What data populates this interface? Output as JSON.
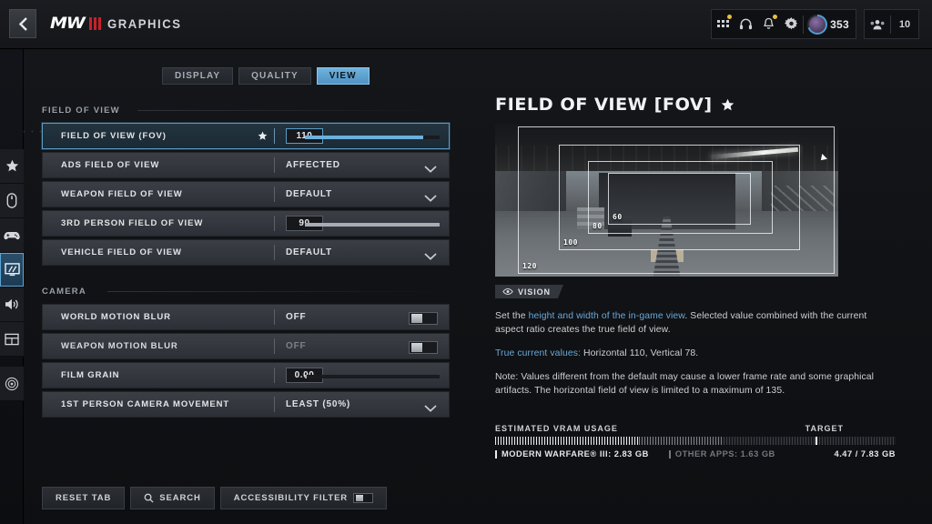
{
  "header": {
    "back_icon": "chevron-left-icon",
    "logo_text": "MW",
    "title": "GRAPHICS",
    "icons": [
      {
        "name": "apps-grid-icon",
        "badge": true
      },
      {
        "name": "headset-icon",
        "badge": false
      },
      {
        "name": "bell-icon",
        "badge": true
      },
      {
        "name": "gear-icon",
        "badge": false
      }
    ],
    "currency_value": "353",
    "squad_icon": "squad-icon",
    "squad_value": "10"
  },
  "rail": {
    "items": [
      {
        "name": "star-icon",
        "active": false
      },
      {
        "name": "mouse-icon",
        "active": false
      },
      {
        "name": "gamepad-icon",
        "active": false
      },
      {
        "name": "display-icon",
        "active": true
      },
      {
        "name": "audio-icon",
        "active": false
      },
      {
        "name": "interface-icon",
        "active": false
      },
      {
        "name": "telemetry-icon",
        "active": false
      }
    ]
  },
  "tabs": [
    {
      "label": "DISPLAY",
      "active": false
    },
    {
      "label": "QUALITY",
      "active": false
    },
    {
      "label": "VIEW",
      "active": true
    }
  ],
  "sections": [
    {
      "title": "FIELD OF VIEW",
      "rows": [
        {
          "label": "FIELD OF VIEW (FOV)",
          "type": "slider",
          "value": "110",
          "fill_percent": 88,
          "selected": true,
          "favorite": true
        },
        {
          "label": "ADS FIELD OF VIEW",
          "type": "dropdown",
          "value": "AFFECTED"
        },
        {
          "label": "WEAPON FIELD OF VIEW",
          "type": "dropdown",
          "value": "DEFAULT"
        },
        {
          "label": "3RD PERSON FIELD OF VIEW",
          "type": "slider",
          "value": "90",
          "fill_percent": 100
        },
        {
          "label": "VEHICLE FIELD OF VIEW",
          "type": "dropdown",
          "value": "DEFAULT"
        }
      ]
    },
    {
      "title": "CAMERA",
      "rows": [
        {
          "label": "WORLD MOTION BLUR",
          "type": "toggle",
          "value": "OFF",
          "on": false
        },
        {
          "label": "WEAPON MOTION BLUR",
          "type": "toggle",
          "value": "OFF",
          "on": false,
          "dimmed": true
        },
        {
          "label": "FILM GRAIN",
          "type": "slider",
          "value": "0.00",
          "fill_percent": 0
        },
        {
          "label": "1ST PERSON CAMERA MOVEMENT",
          "type": "dropdown",
          "value": "LEAST (50%)"
        }
      ]
    }
  ],
  "bottom_bar": {
    "reset_label": "RESET TAB",
    "search_label": "SEARCH",
    "search_icon": "magnifier-icon",
    "accessibility_label": "ACCESSIBILITY FILTER",
    "accessibility_on": false
  },
  "detail": {
    "title": "FIELD OF VIEW [FOV]",
    "favorite_icon": "star-icon",
    "preview": {
      "frames": [
        {
          "label": "120",
          "value": 120
        },
        {
          "label": "100",
          "value": 100
        },
        {
          "label": "80",
          "value": 80
        },
        {
          "label": "60",
          "value": 60
        }
      ]
    },
    "badge_label": "VISION",
    "badge_icon": "eye-icon",
    "desc_1_pre": "Set the ",
    "desc_1_hl": "height and width of the in-game view",
    "desc_1_post": ". Selected value combined with the current aspect ratio creates the true field of view.",
    "desc_2_hl": "True current values:",
    "desc_2_post": " Horizontal 110, Vertical 78.",
    "desc_3": "Note: Values different from the default may cause a lower frame rate and some graphical artifacts. The horizontal field of view is limited to a maximum of 135."
  },
  "vram": {
    "label": "ESTIMATED VRAM USAGE",
    "target_label": "TARGET",
    "game_label": "MODERN WARFARE® III: 2.83 GB",
    "other_label": "OTHER APPS: 1.63 GB",
    "total_label": "4.47 / 7.83 GB",
    "game_percent": 36,
    "other_percent": 21,
    "target_percent": 80
  },
  "colors": {
    "accent": "#6bb0dd",
    "brand_red": "#c8202a",
    "badge": "#e8c03a"
  }
}
